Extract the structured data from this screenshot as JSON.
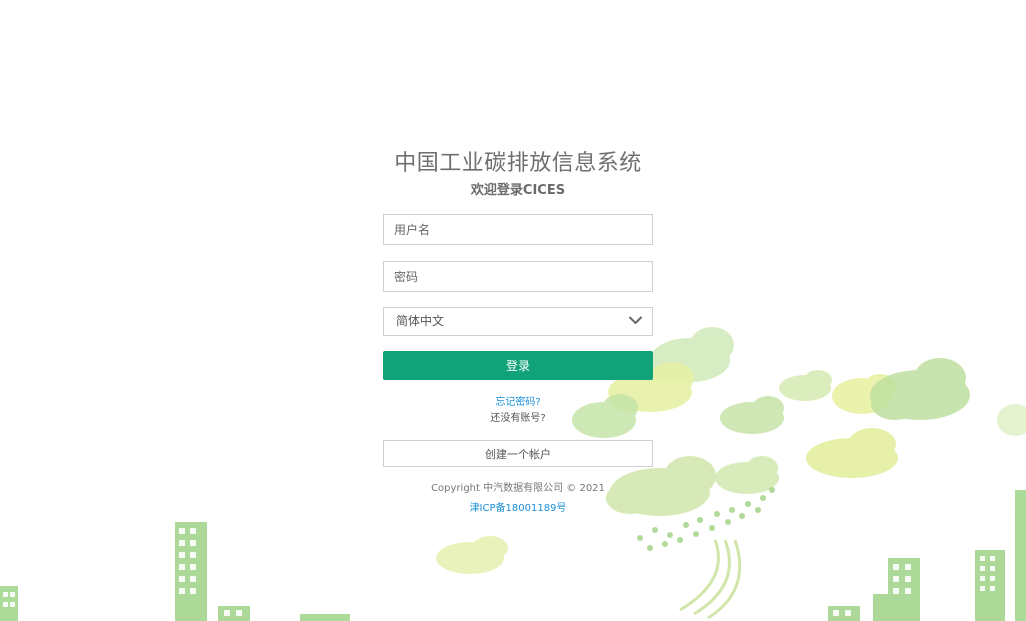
{
  "header": {
    "title": "中国工业碳排放信息系统",
    "subtitle": "欢迎登录CICES"
  },
  "form": {
    "username_placeholder": "用户名",
    "password_placeholder": "密码",
    "language_selected": "简体中文",
    "login_label": "登录",
    "forgot_password": "忘记密码?",
    "no_account": "还没有账号?",
    "create_account_label": "创建一个帐户"
  },
  "footer": {
    "copyright": "Copyright 中汽数据有限公司 © 2021",
    "icp": "津ICP备18001189号"
  },
  "icons": {
    "language_dropdown": "chevron-down-icon"
  },
  "colors": {
    "primary_button": "#10a37a",
    "link": "#1a8fd8",
    "illustration_green": "#9fd68a",
    "illustration_yellow": "#e4ee96"
  }
}
